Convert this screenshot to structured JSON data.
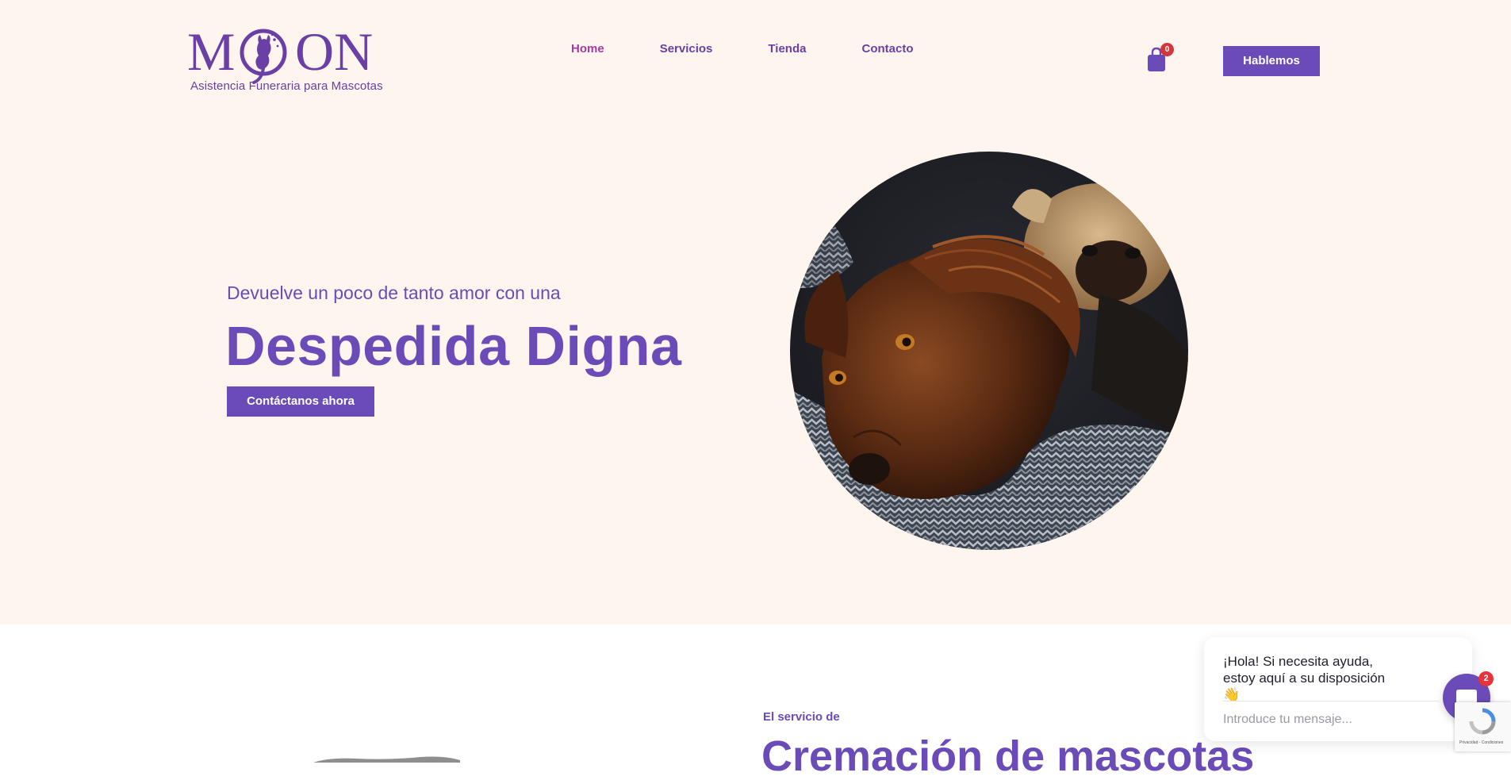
{
  "header": {
    "logo": {
      "wordmark": "MOON",
      "wordmark_start": "M",
      "wordmark_end": "ON",
      "tagline": "Asistencia Funeraria para Mascotas"
    },
    "nav": [
      {
        "label": "Home",
        "active": true
      },
      {
        "label": "Servicios",
        "active": false
      },
      {
        "label": "Tienda",
        "active": false
      },
      {
        "label": "Contacto",
        "active": false
      }
    ],
    "cart": {
      "count": "0",
      "icon": "shopping-bag-icon"
    },
    "cta_label": "Hablemos"
  },
  "hero": {
    "kicker": "Devuelve un poco de tanto amor con una",
    "title": "Despedida Digna",
    "button_label": "Contáctanos ahora",
    "image_alt": "dogs"
  },
  "section2": {
    "kicker": "El servicio de",
    "title": "Cremación de mascotas"
  },
  "chat": {
    "greeting": "¡Hola! Si necesita ayuda, estoy aquí a su disposición",
    "emoji": "👋",
    "input_placeholder": "Introduce tu mensaje...",
    "badge_count": "2",
    "icon": "chat-icon"
  },
  "recaptcha": {
    "text": "Privacidad - Condiciones"
  },
  "colors": {
    "brand_purple": "#6a4bb8",
    "nav_active": "#a23ca3",
    "hero_bg": "#fef5ee",
    "badge_red": "#d3373c"
  }
}
